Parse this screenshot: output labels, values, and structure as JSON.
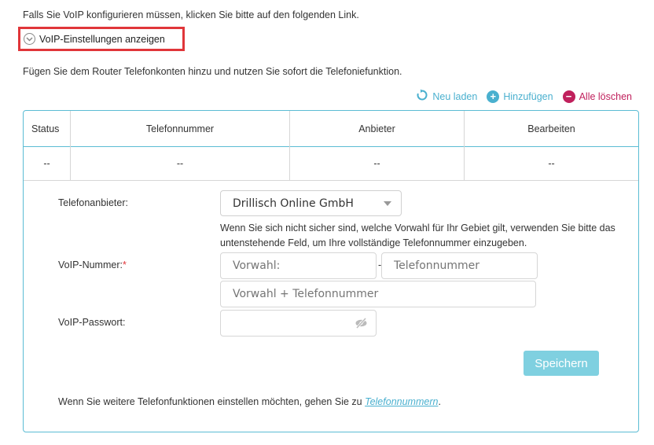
{
  "intro_text": "Falls Sie VoIP konfigurieren müssen, klicken Sie bitte auf den folgenden Link.",
  "voip_toggle_label": "VoIP-Einstellungen anzeigen",
  "description": "Fügen Sie dem Router Telefonkonten hinzu und nutzen Sie sofort die Telefoniefunktion.",
  "actions": {
    "reload": "Neu laden",
    "add": "Hinzufügen",
    "delete_all": "Alle löschen"
  },
  "table": {
    "headers": [
      "Status",
      "Telefonnummer",
      "Anbieter",
      "Bearbeiten"
    ],
    "row": [
      "--",
      "--",
      "--",
      "--"
    ]
  },
  "form": {
    "provider_label": "Telefonanbieter:",
    "provider_value": "Drillisch Online GmbH",
    "hint": "Wenn Sie sich nicht sicher sind, welche Vorwahl für Ihr Gebiet gilt, verwenden Sie bitte das untenstehende Feld, um Ihre vollständige Telefonnummer einzugeben.",
    "voip_number_label": "VoIP-Nummer:",
    "required_mark": "*",
    "area_code_placeholder": "Vorwahl:",
    "separator": "-",
    "phone_placeholder": "Telefonnummer",
    "full_number_placeholder": "Vorwahl + Telefonnummer",
    "password_label": "VoIP-Passwort:",
    "save_label": "Speichern",
    "footer_prefix": "Wenn Sie weitere Telefonfunktionen einstellen möchten, gehen Sie zu",
    "footer_link": "Telefonnummern",
    "footer_suffix": "."
  },
  "colors": {
    "accent": "#4ab0cf",
    "danger": "#c0205c",
    "highlight": "#e0363a",
    "button": "#7fd0e0"
  }
}
